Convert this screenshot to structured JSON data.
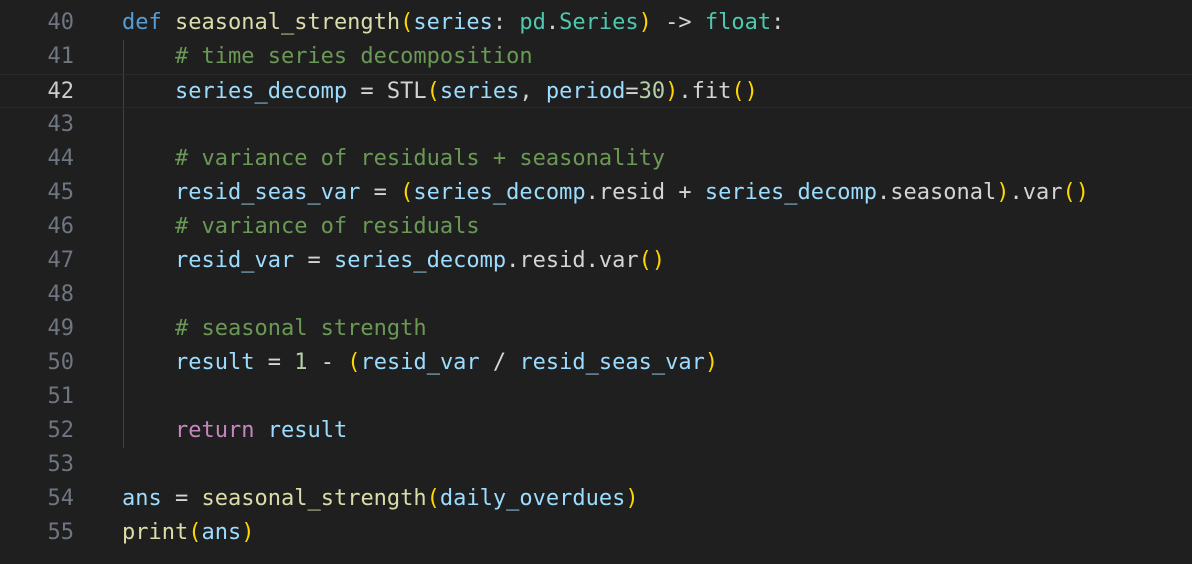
{
  "editor": {
    "colors": {
      "background": "#1f1f1f",
      "line_number": "#6e7681",
      "line_number_active": "#cccccc",
      "keyword": "#569cd6",
      "control_keyword": "#c586c0",
      "function": "#dcdcaa",
      "variable": "#9cdcfe",
      "type": "#4ec9b0",
      "comment": "#6a9955",
      "number": "#b5cea8",
      "plain": "#d4d4d4",
      "bracket": "#ffd700"
    },
    "active_line": "42",
    "lines": [
      {
        "number": "40",
        "tokens": [
          {
            "t": "def",
            "c": "keyword"
          },
          {
            "t": " ",
            "c": "plain"
          },
          {
            "t": "seasonal_strength",
            "c": "function"
          },
          {
            "t": "(",
            "c": "bracket"
          },
          {
            "t": "series",
            "c": "variable"
          },
          {
            "t": ": ",
            "c": "plain"
          },
          {
            "t": "pd",
            "c": "type"
          },
          {
            "t": ".",
            "c": "plain"
          },
          {
            "t": "Series",
            "c": "type"
          },
          {
            "t": ")",
            "c": "bracket"
          },
          {
            "t": " -> ",
            "c": "plain"
          },
          {
            "t": "float",
            "c": "type"
          },
          {
            "t": ":",
            "c": "plain"
          }
        ]
      },
      {
        "number": "41",
        "tokens": [
          {
            "t": "    ",
            "c": "plain"
          },
          {
            "t": "# time series decomposition",
            "c": "comment"
          }
        ]
      },
      {
        "number": "42",
        "tokens": [
          {
            "t": "    ",
            "c": "plain"
          },
          {
            "t": "series_decomp",
            "c": "variable"
          },
          {
            "t": " = ",
            "c": "plain"
          },
          {
            "t": "STL",
            "c": "plain"
          },
          {
            "t": "(",
            "c": "bracket"
          },
          {
            "t": "series",
            "c": "variable"
          },
          {
            "t": ", ",
            "c": "plain"
          },
          {
            "t": "period",
            "c": "variable"
          },
          {
            "t": "=",
            "c": "plain"
          },
          {
            "t": "30",
            "c": "number"
          },
          {
            "t": ")",
            "c": "bracket"
          },
          {
            "t": ".fit",
            "c": "plain"
          },
          {
            "t": "()",
            "c": "bracket"
          }
        ]
      },
      {
        "number": "43",
        "tokens": []
      },
      {
        "number": "44",
        "tokens": [
          {
            "t": "    ",
            "c": "plain"
          },
          {
            "t": "# variance of residuals + seasonality",
            "c": "comment"
          }
        ]
      },
      {
        "number": "45",
        "tokens": [
          {
            "t": "    ",
            "c": "plain"
          },
          {
            "t": "resid_seas_var",
            "c": "variable"
          },
          {
            "t": " = ",
            "c": "plain"
          },
          {
            "t": "(",
            "c": "bracket"
          },
          {
            "t": "series_decomp",
            "c": "variable"
          },
          {
            "t": ".resid + ",
            "c": "plain"
          },
          {
            "t": "series_decomp",
            "c": "variable"
          },
          {
            "t": ".seasonal",
            "c": "plain"
          },
          {
            "t": ")",
            "c": "bracket"
          },
          {
            "t": ".var",
            "c": "plain"
          },
          {
            "t": "()",
            "c": "bracket"
          }
        ]
      },
      {
        "number": "46",
        "tokens": [
          {
            "t": "    ",
            "c": "plain"
          },
          {
            "t": "# variance of residuals",
            "c": "comment"
          }
        ]
      },
      {
        "number": "47",
        "tokens": [
          {
            "t": "    ",
            "c": "plain"
          },
          {
            "t": "resid_var",
            "c": "variable"
          },
          {
            "t": " = ",
            "c": "plain"
          },
          {
            "t": "series_decomp",
            "c": "variable"
          },
          {
            "t": ".resid.var",
            "c": "plain"
          },
          {
            "t": "()",
            "c": "bracket"
          }
        ]
      },
      {
        "number": "48",
        "tokens": []
      },
      {
        "number": "49",
        "tokens": [
          {
            "t": "    ",
            "c": "plain"
          },
          {
            "t": "# seasonal strength",
            "c": "comment"
          }
        ]
      },
      {
        "number": "50",
        "tokens": [
          {
            "t": "    ",
            "c": "plain"
          },
          {
            "t": "result",
            "c": "variable"
          },
          {
            "t": " = ",
            "c": "plain"
          },
          {
            "t": "1",
            "c": "number"
          },
          {
            "t": " - ",
            "c": "plain"
          },
          {
            "t": "(",
            "c": "bracket"
          },
          {
            "t": "resid_var",
            "c": "variable"
          },
          {
            "t": " / ",
            "c": "plain"
          },
          {
            "t": "resid_seas_var",
            "c": "variable"
          },
          {
            "t": ")",
            "c": "bracket"
          }
        ]
      },
      {
        "number": "51",
        "tokens": []
      },
      {
        "number": "52",
        "tokens": [
          {
            "t": "    ",
            "c": "plain"
          },
          {
            "t": "return",
            "c": "control"
          },
          {
            "t": " ",
            "c": "plain"
          },
          {
            "t": "result",
            "c": "variable"
          }
        ]
      },
      {
        "number": "53",
        "tokens": []
      },
      {
        "number": "54",
        "tokens": [
          {
            "t": "ans",
            "c": "variable"
          },
          {
            "t": " = ",
            "c": "plain"
          },
          {
            "t": "seasonal_strength",
            "c": "function"
          },
          {
            "t": "(",
            "c": "bracket"
          },
          {
            "t": "daily_overdues",
            "c": "variable"
          },
          {
            "t": ")",
            "c": "bracket"
          }
        ]
      },
      {
        "number": "55",
        "tokens": [
          {
            "t": "print",
            "c": "function"
          },
          {
            "t": "(",
            "c": "bracket"
          },
          {
            "t": "ans",
            "c": "variable"
          },
          {
            "t": ")",
            "c": "bracket"
          }
        ]
      }
    ]
  }
}
